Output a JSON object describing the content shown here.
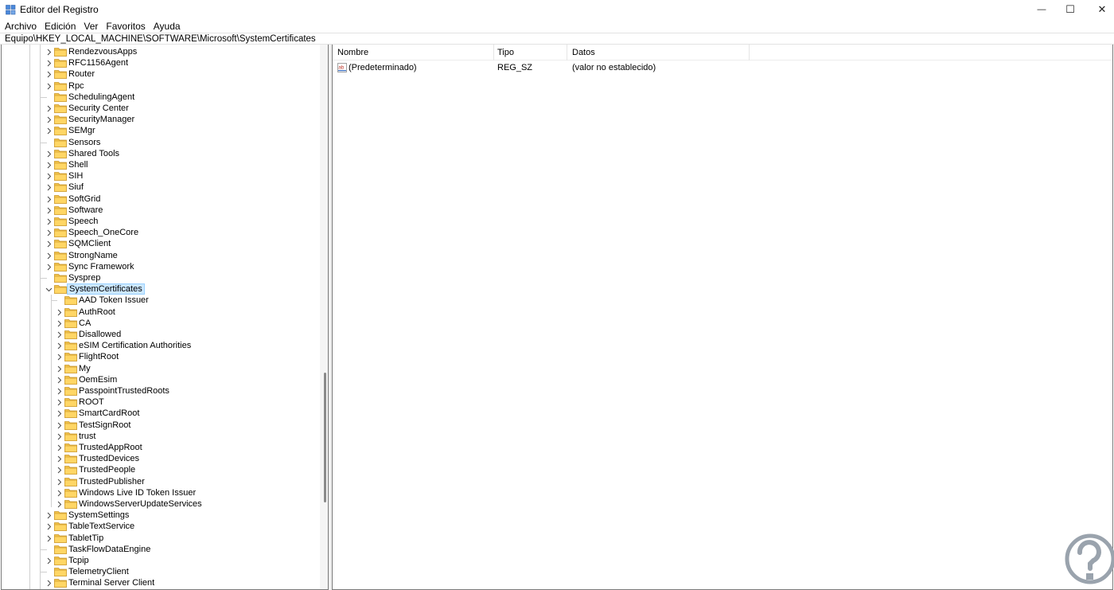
{
  "window": {
    "title": "Editor del Registro",
    "minimize_glyph": "—",
    "maximize_glyph": "☐",
    "close_glyph": "✕"
  },
  "menu": [
    "Archivo",
    "Edición",
    "Ver",
    "Favoritos",
    "Ayuda"
  ],
  "address": "Equipo\\HKEY_LOCAL_MACHINE\\SOFTWARE\\Microsoft\\SystemCertificates",
  "tree": {
    "items": [
      {
        "label": "RendezvousApps",
        "level": 0,
        "expander": "collapsed"
      },
      {
        "label": "RFC1156Agent",
        "level": 0,
        "expander": "collapsed"
      },
      {
        "label": "Router",
        "level": 0,
        "expander": "collapsed"
      },
      {
        "label": "Rpc",
        "level": 0,
        "expander": "collapsed"
      },
      {
        "label": "SchedulingAgent",
        "level": 0,
        "expander": "none"
      },
      {
        "label": "Security Center",
        "level": 0,
        "expander": "collapsed"
      },
      {
        "label": "SecurityManager",
        "level": 0,
        "expander": "collapsed"
      },
      {
        "label": "SEMgr",
        "level": 0,
        "expander": "collapsed"
      },
      {
        "label": "Sensors",
        "level": 0,
        "expander": "none"
      },
      {
        "label": "Shared Tools",
        "level": 0,
        "expander": "collapsed"
      },
      {
        "label": "Shell",
        "level": 0,
        "expander": "collapsed"
      },
      {
        "label": "SIH",
        "level": 0,
        "expander": "collapsed"
      },
      {
        "label": "Siuf",
        "level": 0,
        "expander": "collapsed"
      },
      {
        "label": "SoftGrid",
        "level": 0,
        "expander": "collapsed"
      },
      {
        "label": "Software",
        "level": 0,
        "expander": "collapsed"
      },
      {
        "label": "Speech",
        "level": 0,
        "expander": "collapsed"
      },
      {
        "label": "Speech_OneCore",
        "level": 0,
        "expander": "collapsed"
      },
      {
        "label": "SQMClient",
        "level": 0,
        "expander": "collapsed"
      },
      {
        "label": "StrongName",
        "level": 0,
        "expander": "collapsed"
      },
      {
        "label": "Sync Framework",
        "level": 0,
        "expander": "collapsed"
      },
      {
        "label": "Sysprep",
        "level": 0,
        "expander": "none"
      },
      {
        "label": "SystemCertificates",
        "level": 0,
        "expander": "expanded",
        "selected": true
      },
      {
        "label": "AAD Token Issuer",
        "level": 1,
        "expander": "none"
      },
      {
        "label": "AuthRoot",
        "level": 1,
        "expander": "collapsed"
      },
      {
        "label": "CA",
        "level": 1,
        "expander": "collapsed"
      },
      {
        "label": "Disallowed",
        "level": 1,
        "expander": "collapsed"
      },
      {
        "label": "eSIM Certification Authorities",
        "level": 1,
        "expander": "collapsed"
      },
      {
        "label": "FlightRoot",
        "level": 1,
        "expander": "collapsed"
      },
      {
        "label": "My",
        "level": 1,
        "expander": "collapsed"
      },
      {
        "label": "OemEsim",
        "level": 1,
        "expander": "collapsed"
      },
      {
        "label": "PasspointTrustedRoots",
        "level": 1,
        "expander": "collapsed"
      },
      {
        "label": "ROOT",
        "level": 1,
        "expander": "collapsed"
      },
      {
        "label": "SmartCardRoot",
        "level": 1,
        "expander": "collapsed"
      },
      {
        "label": "TestSignRoot",
        "level": 1,
        "expander": "collapsed"
      },
      {
        "label": "trust",
        "level": 1,
        "expander": "collapsed"
      },
      {
        "label": "TrustedAppRoot",
        "level": 1,
        "expander": "collapsed"
      },
      {
        "label": "TrustedDevices",
        "level": 1,
        "expander": "collapsed"
      },
      {
        "label": "TrustedPeople",
        "level": 1,
        "expander": "collapsed"
      },
      {
        "label": "TrustedPublisher",
        "level": 1,
        "expander": "collapsed"
      },
      {
        "label": "Windows Live ID Token Issuer",
        "level": 1,
        "expander": "collapsed"
      },
      {
        "label": "WindowsServerUpdateServices",
        "level": 1,
        "expander": "collapsed"
      },
      {
        "label": "SystemSettings",
        "level": 0,
        "expander": "collapsed"
      },
      {
        "label": "TableTextService",
        "level": 0,
        "expander": "collapsed"
      },
      {
        "label": "TabletTip",
        "level": 0,
        "expander": "collapsed"
      },
      {
        "label": "TaskFlowDataEngine",
        "level": 0,
        "expander": "none"
      },
      {
        "label": "Tcpip",
        "level": 0,
        "expander": "collapsed"
      },
      {
        "label": "TelemetryClient",
        "level": 0,
        "expander": "none"
      },
      {
        "label": "Terminal Server Client",
        "level": 0,
        "expander": "collapsed"
      }
    ]
  },
  "values": {
    "columns": [
      "Nombre",
      "Tipo",
      "Datos"
    ],
    "rows": [
      {
        "name": "(Predeterminado)",
        "type": "REG_SZ",
        "data": "(valor no establecido)",
        "icon": "string-value-icon"
      }
    ]
  },
  "colors": {
    "folder": "#f3c44a",
    "selection": "#cce8ff",
    "watermark": "#9aa3ad"
  }
}
